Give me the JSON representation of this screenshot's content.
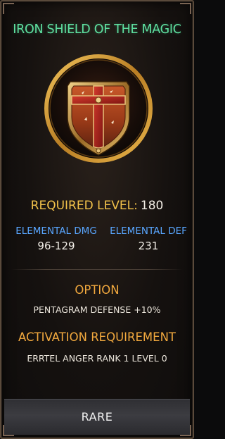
{
  "item": {
    "name": "IRON SHIELD OF THE MAGIC",
    "icon": "cross-shield-icon",
    "required_level_label": "REQUIRED LEVEL:",
    "required_level_value": "180",
    "stats": [
      {
        "name": "ELEMENTAL DMG",
        "value": "96-129"
      },
      {
        "name": "ELEMENTAL DEF",
        "value": "231"
      }
    ],
    "option_heading": "OPTION",
    "option_text": "PENTAGRAM DEFENSE +10%",
    "activation_heading": "ACTIVATION REQUIREMENT",
    "activation_text": "ERRTEL ANGER RANK 1 LEVEL 0",
    "rarity": "RARE"
  },
  "colors": {
    "name": "#5fe0a0",
    "required_label": "#f2c24a",
    "stat_name": "#59a6ff",
    "section_heading": "#f2a93e",
    "frame_gold": "#c9932e",
    "rarity_bar": "#3a3a3f"
  }
}
